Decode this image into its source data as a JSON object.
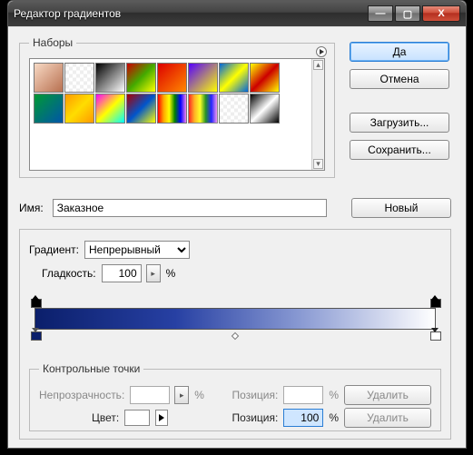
{
  "window": {
    "title": "Редактор градиентов"
  },
  "winbtns": {
    "min": "—",
    "max": "▢",
    "close": "X"
  },
  "presets": {
    "legend": "Наборы"
  },
  "buttons": {
    "ok": "Да",
    "cancel": "Отмена",
    "load": "Загрузить...",
    "save": "Сохранить...",
    "new": "Новый"
  },
  "name": {
    "label": "Имя:",
    "value": "Заказное"
  },
  "gradient": {
    "type_label": "Градиент:",
    "type_value": "Непрерывный",
    "smooth_label": "Гладкость:",
    "smooth_value": "100",
    "percent": "%"
  },
  "stops": {
    "legend": "Контрольные точки",
    "opacity_label": "Непрозрачность:",
    "position_label": "Позиция:",
    "color_label": "Цвет:",
    "percent": "%",
    "delete": "Удалить",
    "pos_value": "100"
  }
}
